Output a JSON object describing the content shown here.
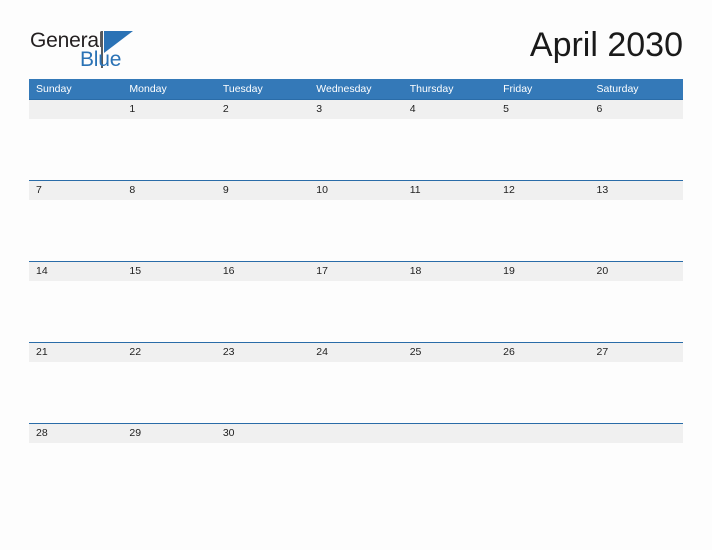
{
  "brand": {
    "name_part1": "General",
    "name_part2": "Blue",
    "accent_color": "#2a72b5"
  },
  "header": {
    "title": "April 2030",
    "month": "April",
    "year": "2030"
  },
  "theme": {
    "header_row_bg": "#3479b8",
    "day_band_bg": "#f0f0f0",
    "row_border": "#2a6ca8",
    "page_bg": "#fdfdfd",
    "text_color": "#222222"
  },
  "calendar": {
    "weekday_headers": [
      "Sunday",
      "Monday",
      "Tuesday",
      "Wednesday",
      "Thursday",
      "Friday",
      "Saturday"
    ],
    "weeks": [
      [
        "",
        "1",
        "2",
        "3",
        "4",
        "5",
        "6"
      ],
      [
        "7",
        "8",
        "9",
        "10",
        "11",
        "12",
        "13"
      ],
      [
        "14",
        "15",
        "16",
        "17",
        "18",
        "19",
        "20"
      ],
      [
        "21",
        "22",
        "23",
        "24",
        "25",
        "26",
        "27"
      ],
      [
        "28",
        "29",
        "30",
        "",
        "",
        "",
        ""
      ]
    ]
  }
}
